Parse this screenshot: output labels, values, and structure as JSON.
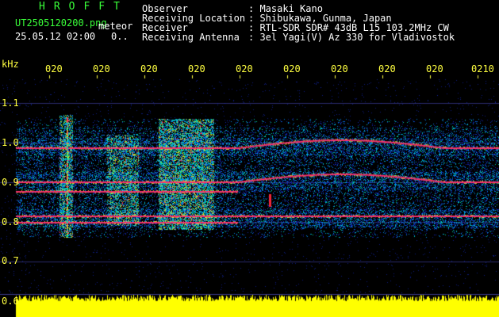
{
  "app": {
    "logo": "HROFFT",
    "filename": "UT2505120200.png",
    "mode": "meteor",
    "datetime": "25.05.12 02:00",
    "counter": "0.."
  },
  "info": {
    "labels": [
      "Observer",
      "Receiving Location",
      "Receiver",
      "Receiving Antenna"
    ],
    "values": [
      ": Masaki Kano",
      ": Shibukawa, Gunma, Japan",
      ": RTL-SDR SDR# 43dB L15 103.2MHz CW",
      ": 3el Yagi(V) Az 330 for Vladivostok"
    ]
  },
  "axes": {
    "y_unit": "kHz",
    "y_ticks": [
      "1.1",
      "1.0",
      "0.9",
      "0.8",
      "0.7",
      "0.6"
    ],
    "x_ticks": [
      "020",
      "020",
      "020",
      "020",
      "020",
      "020",
      "020",
      "020",
      "020",
      "0210"
    ]
  },
  "colors": {
    "header_green": "#39ff39",
    "text_white": "#ffffff",
    "axis_yellow": "#ffff40",
    "background": "#000000"
  }
}
